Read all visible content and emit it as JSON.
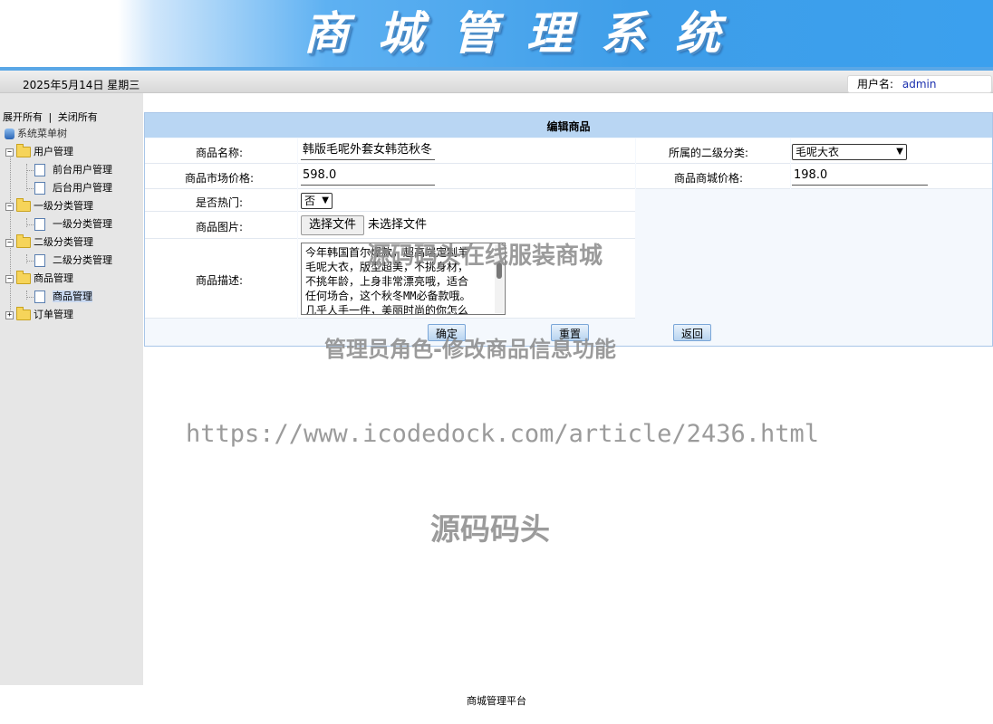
{
  "header": {
    "title": "商城管理系统"
  },
  "infobar": {
    "date": "2025年5月14日 星期三",
    "user_label": "用户名:",
    "user_value": "admin"
  },
  "sidebar": {
    "expand_all": "展开所有",
    "separator": "|",
    "collapse_all": "关闭所有",
    "root": "系统菜单树",
    "groups": [
      {
        "label": "用户管理",
        "items": [
          "前台用户管理",
          "后台用户管理"
        ]
      },
      {
        "label": "一级分类管理",
        "items": [
          "一级分类管理"
        ]
      },
      {
        "label": "二级分类管理",
        "items": [
          "二级分类管理"
        ]
      },
      {
        "label": "商品管理",
        "items": [
          "商品管理"
        ]
      },
      {
        "label": "订单管理",
        "items": []
      }
    ]
  },
  "form": {
    "title": "编辑商品",
    "name_label": "商品名称:",
    "name_value": "韩版毛呢外套女韩范秋冬",
    "category_label": "所属的二级分类:",
    "category_value": "毛呢大衣",
    "market_price_label": "商品市场价格:",
    "market_price_value": "598.0",
    "shop_price_label": "商品商城价格:",
    "shop_price_value": "198.0",
    "hot_label": "是否热门:",
    "hot_value": "否",
    "image_label": "商品图片:",
    "file_button": "选择文件",
    "file_status": "未选择文件",
    "desc_label": "商品描述:",
    "desc_lines": [
      "今年韩国首尔爆款，超高端定制羊",
      "毛呢大衣，版型超美，不挑身材，",
      "不挑年龄，上身非常漂亮哦，适合",
      "任何场合，这个秋冬MM必备款哦。",
      "几乎人手一件，美丽时尚的你怎么"
    ],
    "confirm_button": "确定",
    "reset_button": "重置",
    "back_button": "返回"
  },
  "watermarks": {
    "line1": "源码码头在线服装商城",
    "line2": "管理员角色-修改商品信息功能",
    "line3": "https://www.icodedock.com/article/2436.html",
    "line4": "源码码头"
  },
  "footer": {
    "text": "商城管理平台"
  }
}
